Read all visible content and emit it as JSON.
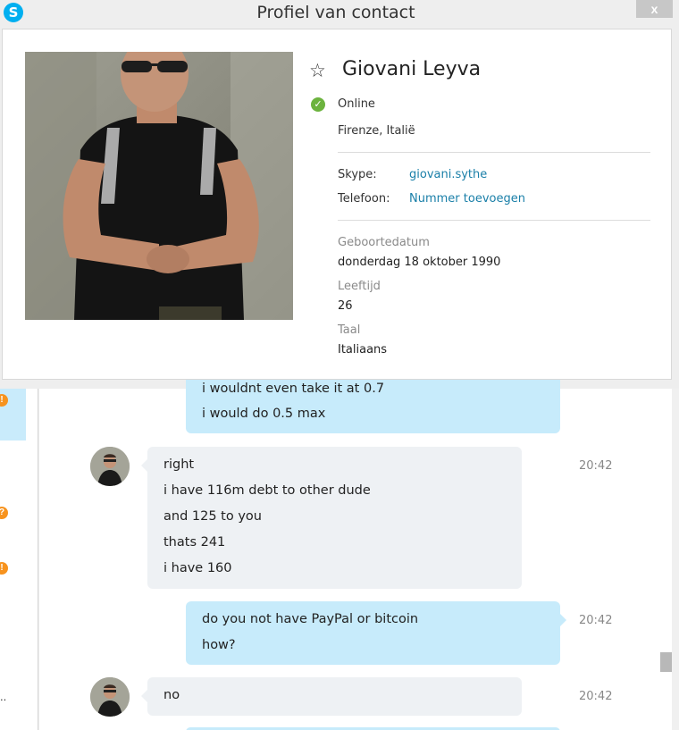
{
  "window": {
    "title": "Profiel van contact",
    "close_label": "x",
    "app_logo": "S"
  },
  "profile": {
    "name": "Giovani Leyva",
    "status": "Online",
    "location": "Firenze, Italië",
    "skype_label": "Skype:",
    "skype_value": "giovani.sythe",
    "phone_label": "Telefoon:",
    "phone_value": "Nummer toevoegen",
    "birthday_label": "Geboortedatum",
    "birthday_value": "donderdag 18 oktober 1990",
    "age_label": "Leeftijd",
    "age_value": "26",
    "language_label": "Taal",
    "language_value": "Italiaans"
  },
  "rail": {
    "badges": [
      "!",
      "?",
      "!"
    ],
    "dots": ".."
  },
  "messages": [
    {
      "direction": "out",
      "lines": [
        "i wouldnt even take it at 0.7",
        "i would do 0.5 max"
      ],
      "time": ""
    },
    {
      "direction": "in",
      "lines": [
        "right",
        "i have 116m debt to other dude",
        "and 125 to you",
        "thats 241",
        "i have 160"
      ],
      "time": "20:42"
    },
    {
      "direction": "out",
      "lines": [
        "do you not have PayPal or bitcoin",
        "how?"
      ],
      "time": "20:42"
    },
    {
      "direction": "in",
      "lines": [
        "no"
      ],
      "time": "20:42"
    }
  ],
  "colors": {
    "accent": "#00aff0",
    "online": "#6cb33e",
    "link": "#1a7fa8",
    "bubble_out": "#c7ebfb",
    "bubble_in": "#eef1f4"
  }
}
